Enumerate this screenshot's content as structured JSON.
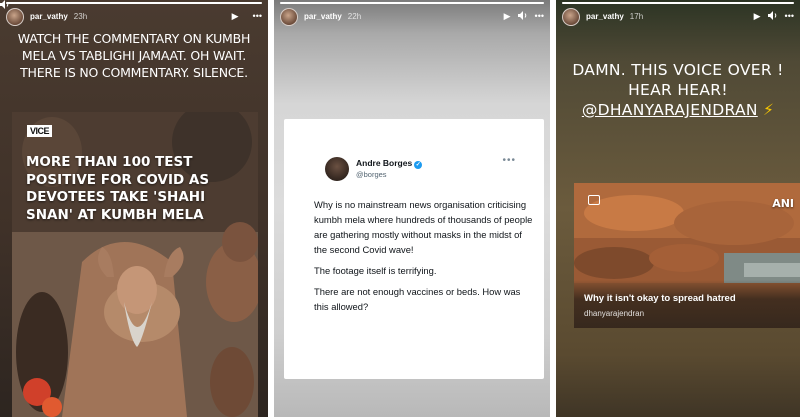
{
  "stories": [
    {
      "username": "par_vathy",
      "time": "23h",
      "progress": 1.0,
      "text": "WATCH THE COMMENTARY ON KUMBH MELA VS TABLIGHI JAMAAT. OH WAIT. THERE IS NO COMMENTARY. SILENCE.",
      "media": {
        "logo": "VICE",
        "headline": "MORE THAN 100 TEST POSITIVE FOR COVID AS DEVOTEES TAKE 'SHAHI SNAN' AT KUMBH MELA"
      }
    },
    {
      "username": "par_vathy",
      "time": "22h",
      "progress": 1.0,
      "tweet": {
        "name": "Andre Borges",
        "handle": "@borges",
        "paragraphs": [
          "Why is no mainstream news organisation criticising kumbh mela where hundreds of thousands of people are gathering mostly without masks in the midst of the second Covid wave!",
          "The footage itself is terrifying.",
          "There are not enough vaccines or beds. How was this allowed?"
        ]
      }
    },
    {
      "username": "par_vathy",
      "time": "17h",
      "progress": 1.0,
      "text": "DAMN. THIS VOICE OVER ! HEAR HEAR!",
      "mention": "@DHANYARAJENDRAN",
      "emoji": "⚡",
      "card": {
        "badge": "ANI",
        "title": "Why it isn't okay to spread hatred",
        "subtitle": "dhanyarajendran"
      }
    }
  ],
  "icons": {
    "play": "▶",
    "mute": "🔈",
    "more": "•••"
  },
  "colors": {
    "verified": "#1d9bf0",
    "bolt": "#f7c600"
  }
}
